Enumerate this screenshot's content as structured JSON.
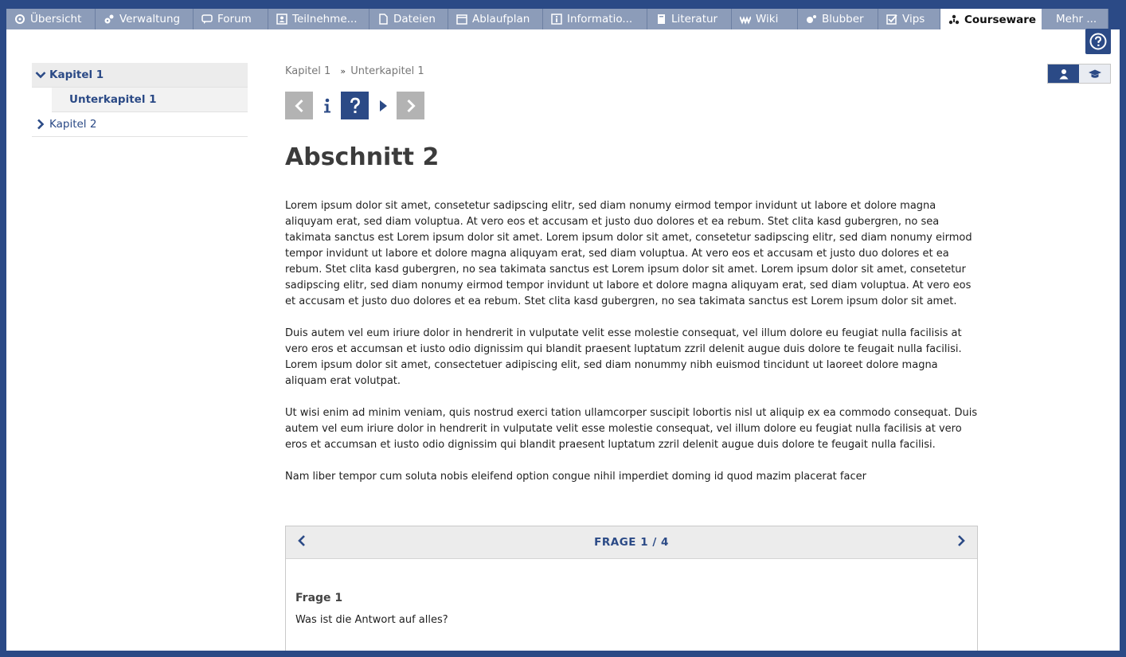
{
  "tabs": [
    {
      "label": "Übersicht",
      "icon": "overview-icon"
    },
    {
      "label": "Verwaltung",
      "icon": "gears-icon"
    },
    {
      "label": "Forum",
      "icon": "forum-icon"
    },
    {
      "label": "Teilnehme...",
      "icon": "participants-icon"
    },
    {
      "label": "Dateien",
      "icon": "files-icon"
    },
    {
      "label": "Ablaufplan",
      "icon": "schedule-icon"
    },
    {
      "label": "Informatio...",
      "icon": "info-icon"
    },
    {
      "label": "Literatur",
      "icon": "literature-icon"
    },
    {
      "label": "Wiki",
      "icon": "wiki-icon"
    },
    {
      "label": "Blubber",
      "icon": "blubber-icon"
    },
    {
      "label": "Vips",
      "icon": "vips-icon"
    },
    {
      "label": "Courseware",
      "icon": "courseware-icon",
      "active": true
    },
    {
      "label": "Mehr ...",
      "icon": ""
    }
  ],
  "sidebar": {
    "items": [
      {
        "label": "Kapitel 1",
        "state": "expanded"
      },
      {
        "label": "Unterkapitel 1",
        "state": "selected-sub"
      },
      {
        "label": "Kapitel 2",
        "state": "collapsed"
      }
    ]
  },
  "breadcrumb": {
    "first": "Kapitel 1",
    "separator": "»",
    "second": "Unterkapitel 1"
  },
  "section_title": "Abschnitt 2",
  "paragraphs": [
    "Lorem ipsum dolor sit amet, consetetur sadipscing elitr, sed diam nonumy eirmod tempor invidunt ut labore et dolore magna aliquyam erat, sed diam voluptua. At vero eos et accusam et justo duo dolores et ea rebum. Stet clita kasd gubergren, no sea takimata sanctus est Lorem ipsum dolor sit amet. Lorem ipsum dolor sit amet, consetetur sadipscing elitr, sed diam nonumy eirmod tempor invidunt ut labore et dolore magna aliquyam erat, sed diam voluptua. At vero eos et accusam et justo duo dolores et ea rebum. Stet clita kasd gubergren, no sea takimata sanctus est Lorem ipsum dolor sit amet. Lorem ipsum dolor sit amet, consetetur sadipscing elitr, sed diam nonumy eirmod tempor invidunt ut labore et dolore magna aliquyam erat, sed diam voluptua. At vero eos et accusam et justo duo dolores et ea rebum. Stet clita kasd gubergren, no sea takimata sanctus est Lorem ipsum dolor sit amet.",
    "Duis autem vel eum iriure dolor in hendrerit in vulputate velit esse molestie consequat, vel illum dolore eu feugiat nulla facilisis at vero eros et accumsan et iusto odio dignissim qui blandit praesent luptatum zzril delenit augue duis dolore te feugait nulla facilisi. Lorem ipsum dolor sit amet, consectetuer adipiscing elit, sed diam nonummy nibh euismod tincidunt ut laoreet dolore magna aliquam erat volutpat.",
    "Ut wisi enim ad minim veniam, quis nostrud exerci tation ullamcorper suscipit lobortis nisl ut aliquip ex ea commodo consequat. Duis autem vel eum iriure dolor in hendrerit in vulputate velit esse molestie consequat, vel illum dolore eu feugiat nulla facilisis at vero eros et accumsan et iusto odio dignissim qui blandit praesent luptatum zzril delenit augue duis dolore te feugait nulla facilisi.",
    "Nam liber tempor cum soluta nobis eleifend option congue nihil imperdiet doming id quod mazim placerat facer"
  ],
  "quiz": {
    "header": "FRAGE 1 / 4",
    "question_title": "Frage 1",
    "question_text": "Was ist die Antwort auf alles?"
  },
  "colors": {
    "brand": "#2b4a86",
    "tab_inactive": "#8c9cb9",
    "nav_grey": "#b3b3b3"
  }
}
